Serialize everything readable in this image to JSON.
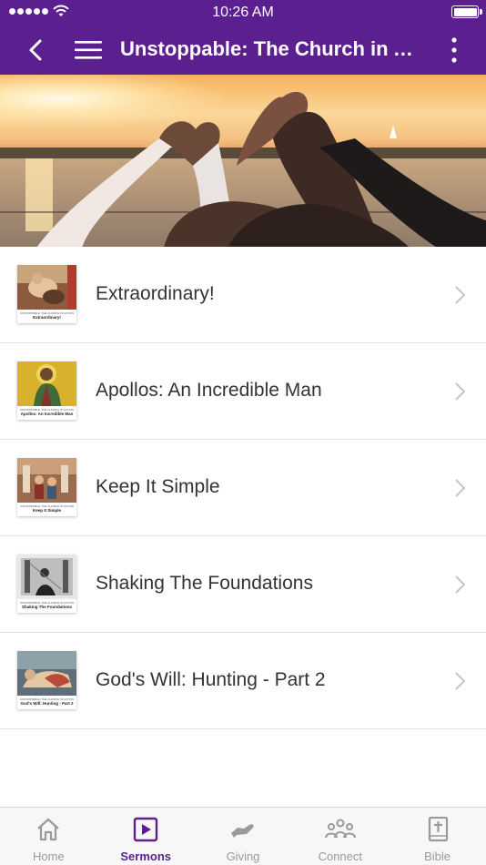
{
  "status_bar": {
    "time": "10:26 AM",
    "signal_icon": "signal-dots-icon",
    "wifi_icon": "wifi-icon",
    "battery_icon": "battery-icon",
    "battery_level": 1.0
  },
  "nav": {
    "title": "Unstoppable: The Church in Action",
    "back_icon": "chevron-left-icon",
    "menu_icon": "hamburger-menu-icon",
    "more_icon": "more-vertical-icon"
  },
  "hero": {
    "image": "hands-forming-hearts-at-sunset"
  },
  "sermons": [
    {
      "title": "Extraordinary!",
      "thumb_caption": "UNSTOPPABLE: THE CHURCH IN ACTION",
      "thumb_title": "Extraordinary!"
    },
    {
      "title": "Apollos: An Incredible Man",
      "thumb_caption": "UNSTOPPABLE: THE CHURCH IN ACTION",
      "thumb_title": "Apollos: An Incredible Man"
    },
    {
      "title": "Keep It Simple",
      "thumb_caption": "UNSTOPPABLE: THE CHURCH IN ACTION",
      "thumb_title": "Keep It Simple"
    },
    {
      "title": "Shaking The Foundations",
      "thumb_caption": "UNSTOPPABLE: THE CHURCH IN ACTION",
      "thumb_title": "Shaking The Foundations"
    },
    {
      "title": "God's Will: Hunting - Part 2",
      "thumb_caption": "UNSTOPPABLE: THE CHURCH IN ACTION",
      "thumb_title": "God's Will: Hunting - Part 2"
    }
  ],
  "tabs": [
    {
      "label": "Home",
      "icon": "home-icon",
      "active": false
    },
    {
      "label": "Sermons",
      "icon": "play-square-icon",
      "active": true
    },
    {
      "label": "Giving",
      "icon": "giving-hand-icon",
      "active": false
    },
    {
      "label": "Connect",
      "icon": "people-group-icon",
      "active": false
    },
    {
      "label": "Bible",
      "icon": "bible-book-icon",
      "active": false
    }
  ],
  "colors": {
    "brand": "#5b1f8f",
    "tab_inactive": "#9a9a9a",
    "divider": "#e3e3e3"
  }
}
